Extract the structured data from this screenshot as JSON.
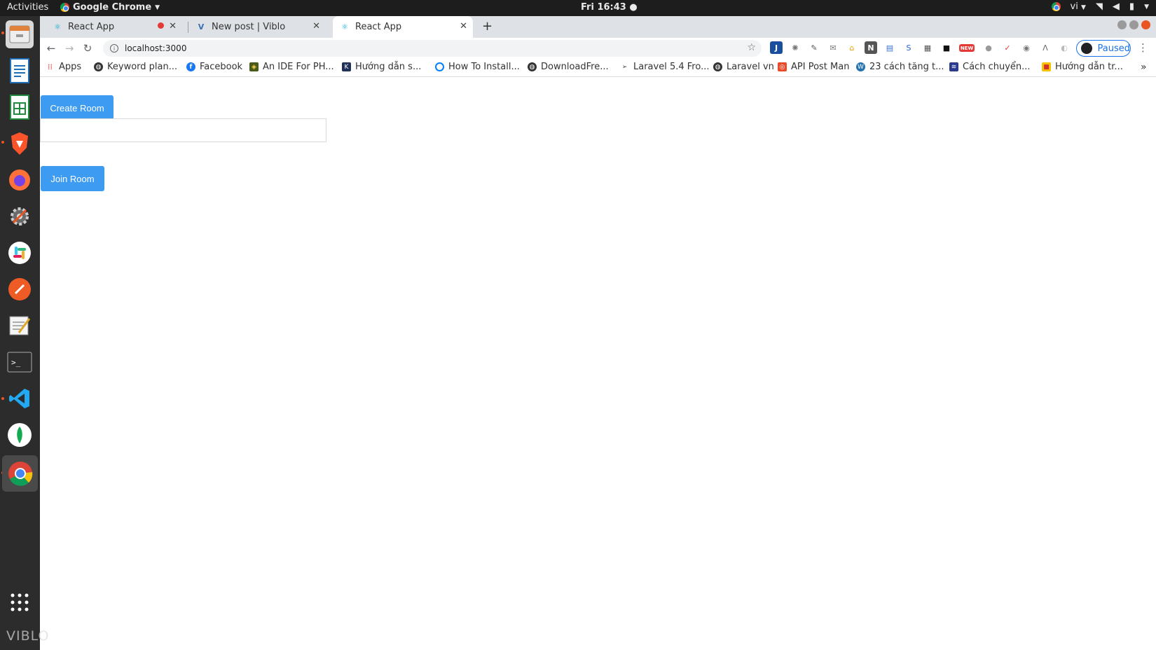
{
  "topbar": {
    "activities": "Activities",
    "app_name": "Google Chrome",
    "clock": "Fri 16:43 ●",
    "lang": "vi"
  },
  "tabs": [
    {
      "label": "React App",
      "active": false
    },
    {
      "label": "New post | Viblo",
      "active": false
    },
    {
      "label": "React App",
      "active": true
    }
  ],
  "omnibox": {
    "url": "localhost:3000"
  },
  "profile": {
    "label": "Paused"
  },
  "bookmarks": [
    "Apps",
    "Keyword plan...",
    "Facebook",
    "An IDE For PH...",
    "Hướng dẫn s...",
    "How To Install...",
    "DownloadFre...",
    "Laravel 5.4 Fro...",
    "Laravel vn",
    "API Post Man",
    "23 cách tăng t...",
    "Cách chuyển...",
    "Hướng dẫn tr..."
  ],
  "page": {
    "create_room_label": "Create Room",
    "join_room_label": "Join Room",
    "room_input_value": ""
  },
  "watermark": "VIBLO",
  "colors": {
    "button": "#3d9bf2",
    "topbar": "#1d1d1d",
    "dock": "#2c2c2c",
    "tabstrip": "#dee1e6"
  }
}
